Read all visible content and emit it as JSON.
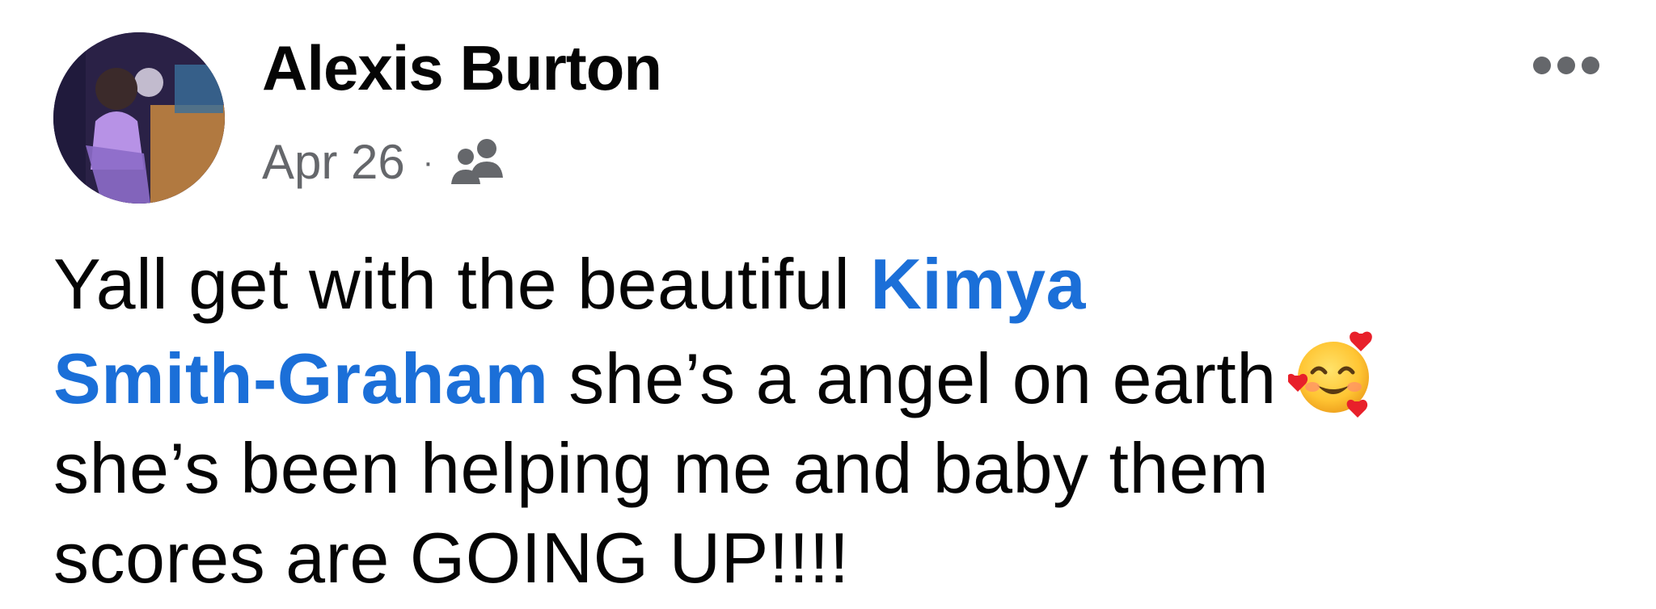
{
  "post": {
    "author": {
      "name": "Alexis Burton"
    },
    "meta": {
      "date": "Apr 26",
      "separator": "·",
      "audience_icon": "friends-icon"
    },
    "more_icon": "more-horizontal-icon",
    "text": {
      "segment_1": "Yall get with the beautiful ",
      "mention_part_1": "Kimya",
      "mention_part_2": "Smith-Graham",
      "segment_2": " she’s a angel on earth",
      "emoji": "smiling-face-with-hearts-emoji",
      "segment_3": "she’s been helping me and baby them",
      "segment_4": "scores are GOING UP!!!!"
    }
  },
  "colors": {
    "text": "#050505",
    "secondary_text": "#65676b",
    "mention": "#1b6fd8",
    "background": "#ffffff"
  }
}
